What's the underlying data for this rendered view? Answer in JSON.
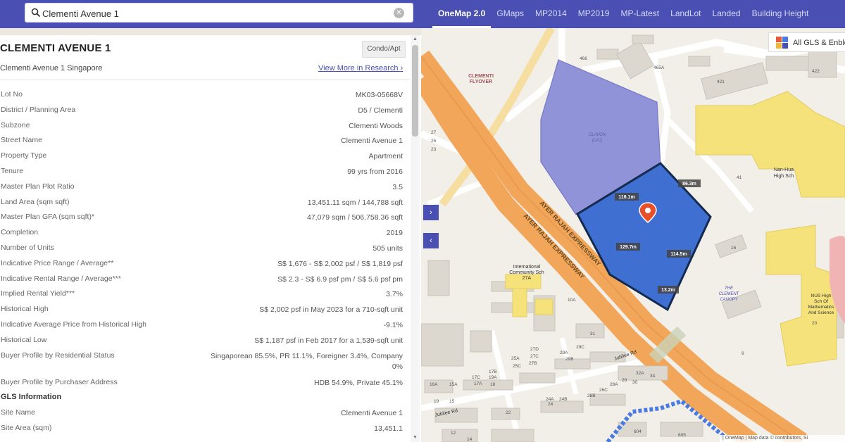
{
  "search": {
    "value": "Clementi Avenue 1"
  },
  "tabs": [
    "OneMap 2.0",
    "GMaps",
    "MP2014",
    "MP2019",
    "MP-Latest",
    "LandLot",
    "Landed",
    "Building Height"
  ],
  "colors": {
    "brand": "#4a4fb4",
    "site_fill": "#3f6fd1",
    "clavon_fill": "#8c8fd8",
    "expressway": "#f2a65a",
    "school": "#f6e27a"
  },
  "panel": {
    "title": "CLEMENTI AVENUE 1",
    "badge": "Condo/Apt",
    "subtitle": "Clementi Avenue 1 Singapore",
    "more_link": "View More in Research",
    "more_chevron": "›",
    "rows": [
      {
        "k": "Lot No",
        "v": "MK03-05668V"
      },
      {
        "k": "District / Planning Area",
        "v": "D5 / Clementi"
      },
      {
        "k": "Subzone",
        "v": "Clementi Woods"
      },
      {
        "k": "Street Name",
        "v": "Clementi Avenue 1"
      },
      {
        "k": "Property Type",
        "v": "Apartment"
      },
      {
        "k": "Tenure",
        "v": "99 yrs from 2016"
      },
      {
        "k": "Master Plan Plot Ratio",
        "v": "3.5"
      },
      {
        "k": "Land Area (sqm sqft)",
        "v": "13,451.11 sqm / 144,788 sqft"
      },
      {
        "k": "Master Plan GFA (sqm sqft)*",
        "v": "47,079 sqm / 506,758.36 sqft"
      },
      {
        "k": "Completion",
        "v": "2019"
      },
      {
        "k": "Number of Units",
        "v": "505 units"
      },
      {
        "k": "Indicative Price Range / Average**",
        "v": "S$ 1,676 - S$ 2,002 psf / S$ 1,819 psf"
      },
      {
        "k": "Indicative Rental Range / Average***",
        "v": "S$ 2.3 - S$ 6.9 psf pm / S$ 5.6 psf pm"
      },
      {
        "k": "Implied Rental Yield***",
        "v": "3.7%"
      },
      {
        "k": "Historical High",
        "v": "S$ 2,002 psf in May 2023 for a 710-sqft unit"
      },
      {
        "k": "Indicative Average Price from Historical High",
        "v": "-9.1%"
      },
      {
        "k": "Historical Low",
        "v": "S$ 1,187 psf in Feb 2017 for a 1,539-sqft unit"
      },
      {
        "k": "Buyer Profile by Residential Status",
        "v": "Singaporean 85.5%, PR 11.1%, Foreigner 3.4%, Company 0%"
      },
      {
        "k": "Buyer Profile by Purchaser Address",
        "v": "HDB 54.9%, Private 45.1%"
      }
    ],
    "gls_header": "GLS Information",
    "gls_rows": [
      {
        "k": "Site Name",
        "v": "Clementi Avenue 1"
      },
      {
        "k": "Site Area (sqm)",
        "v": "13,451.1"
      }
    ]
  },
  "map": {
    "gls_button": "All GLS & Enbloc",
    "expand_btn": "›",
    "collapse_btn": "‹",
    "labels": {
      "clementi_flyover": "CLEMENTI\nFLYOVER",
      "clavon": "CLAVON\n(U/C)",
      "expressway1": "AYER RAJAH EXPRESSWAY",
      "expressway2": "AYER RAJAH EXPRESSWAY",
      "intl_school": "International\nCommunity Sch\n27A",
      "nanhua": "Nan-Hua\nHigh Sch",
      "clement_canopy": "THE\nCLEMENT\nCANOPY",
      "nus_high": "NUS High\nSch Of\nMathematics\nAnd Science",
      "jubilee1": "Jubilee Rd",
      "jubilee2": "Jubilee Rd"
    },
    "dims": [
      "116.1m",
      "86.3m",
      "129.7m",
      "114.5m",
      "13.2m"
    ],
    "blocks": [
      "466",
      "465A",
      "421",
      "422",
      "41",
      "16",
      "20",
      "10A",
      "31",
      "9",
      "604",
      "605",
      "32A",
      "34",
      "30",
      "28A",
      "28",
      "26C",
      "26B",
      "27D",
      "27C",
      "27B",
      "29C",
      "29A",
      "29B",
      "25A",
      "25C",
      "24",
      "24A",
      "24B",
      "22",
      "12",
      "14",
      "15A",
      "17C",
      "19A",
      "17B",
      "17A",
      "16A",
      "18",
      "19",
      "15",
      "27",
      "25",
      "23"
    ],
    "attribution": "| OneMap | Map data © contributors, Si"
  }
}
